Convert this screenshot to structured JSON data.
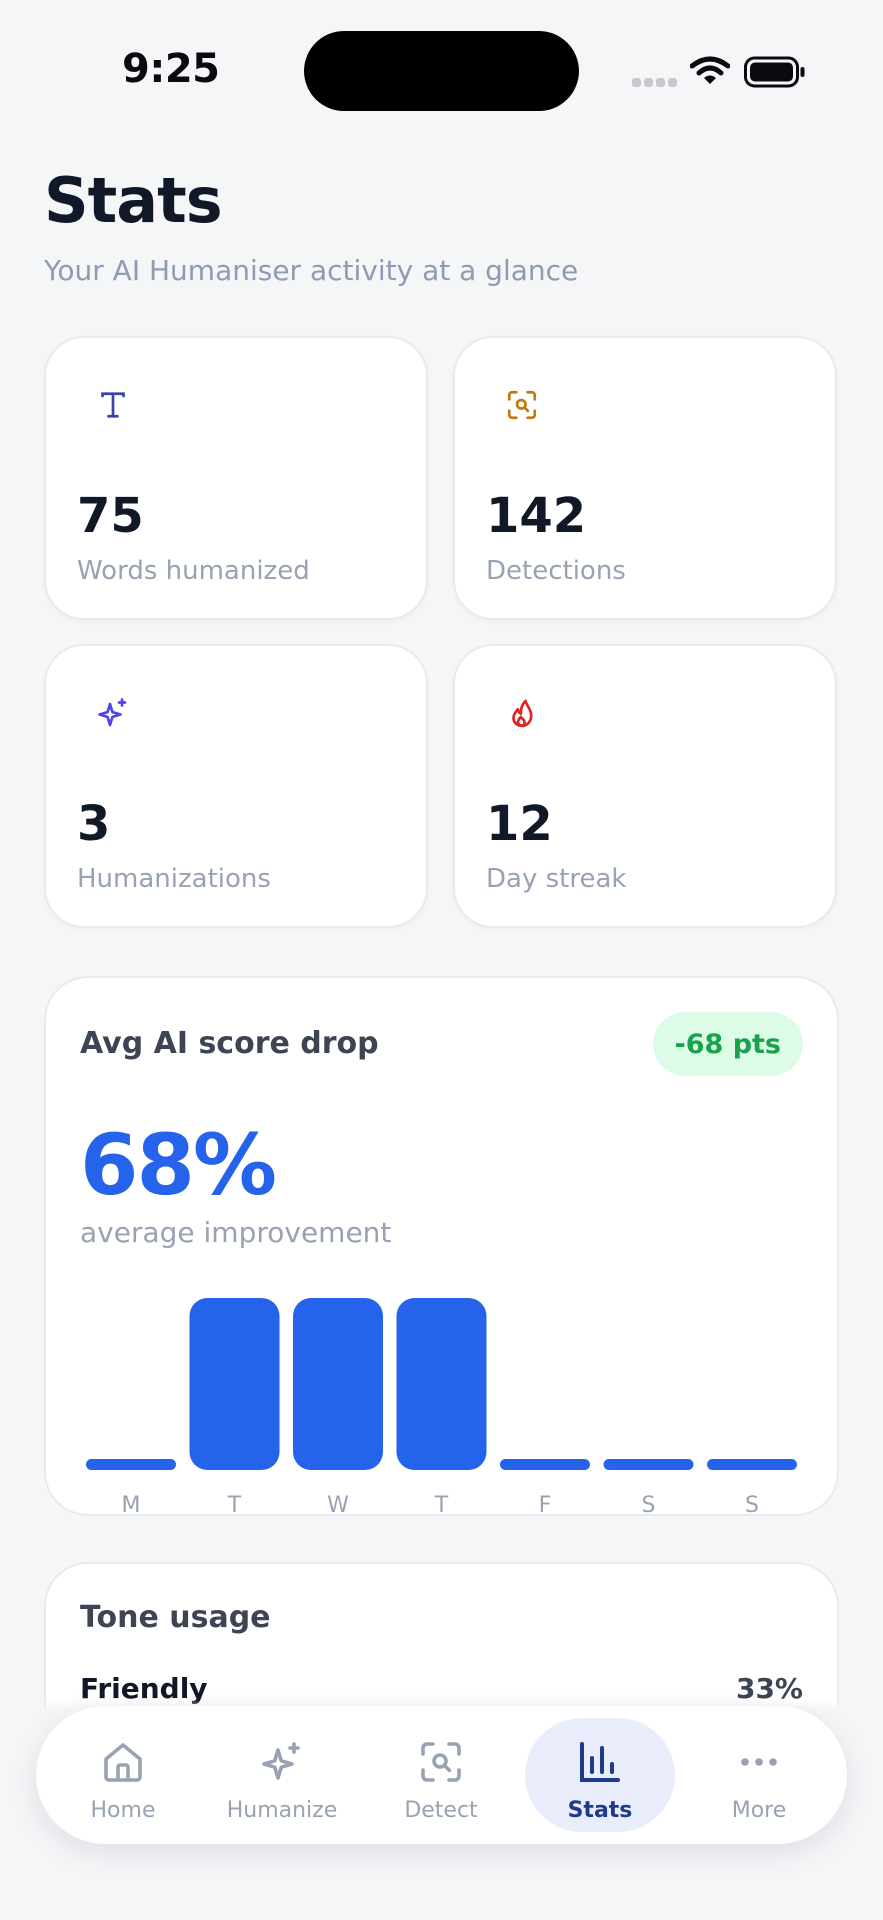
{
  "status": {
    "time": "9:25"
  },
  "header": {
    "title": "Stats",
    "subtitle": "Your AI Humaniser activity at a glance"
  },
  "stats": [
    {
      "value": "75",
      "label": "Words humanized",
      "icon": "text-t-icon",
      "icon_bg": "#e8ecfb",
      "icon_color": "#3545a8"
    },
    {
      "value": "142",
      "label": "Detections",
      "icon": "scan-search-icon",
      "icon_bg": "#fef3c7",
      "icon_color": "#c17a09"
    },
    {
      "value": "3",
      "label": "Humanizations",
      "icon": "sparkles-icon",
      "icon_bg": "#e4e6fd",
      "icon_color": "#4f46e5"
    },
    {
      "value": "12",
      "label": "Day streak",
      "icon": "flame-icon",
      "icon_bg": "#fde2e2",
      "icon_color": "#dc2626"
    }
  ],
  "score": {
    "title": "Avg AI score drop",
    "badge": "-68 pts",
    "value": "68%",
    "caption": "average improvement"
  },
  "chart_data": {
    "type": "bar",
    "categories": [
      "M",
      "T",
      "W",
      "T",
      "F",
      "S",
      "S"
    ],
    "values": [
      0,
      68,
      68,
      68,
      0,
      0,
      0
    ],
    "ylim": [
      0,
      68
    ],
    "grid": false,
    "bar_color": "#2563eb"
  },
  "tone": {
    "title": "Tone usage",
    "items": [
      {
        "name": "Friendly",
        "percent": "33%"
      }
    ]
  },
  "nav": {
    "items": [
      {
        "label": "Home",
        "icon": "home-icon",
        "active": false
      },
      {
        "label": "Humanize",
        "icon": "sparkles-icon",
        "active": false
      },
      {
        "label": "Detect",
        "icon": "scan-search-icon",
        "active": false
      },
      {
        "label": "Stats",
        "icon": "bar-chart-icon",
        "active": true
      },
      {
        "label": "More",
        "icon": "more-dots-icon",
        "active": false
      }
    ]
  },
  "colors": {
    "accent": "#2563eb",
    "positive": "#16a34a",
    "positive_bg": "#dcfce7",
    "nav_active_bg": "#e9edfb",
    "nav_active_text": "#1e3a8a"
  }
}
